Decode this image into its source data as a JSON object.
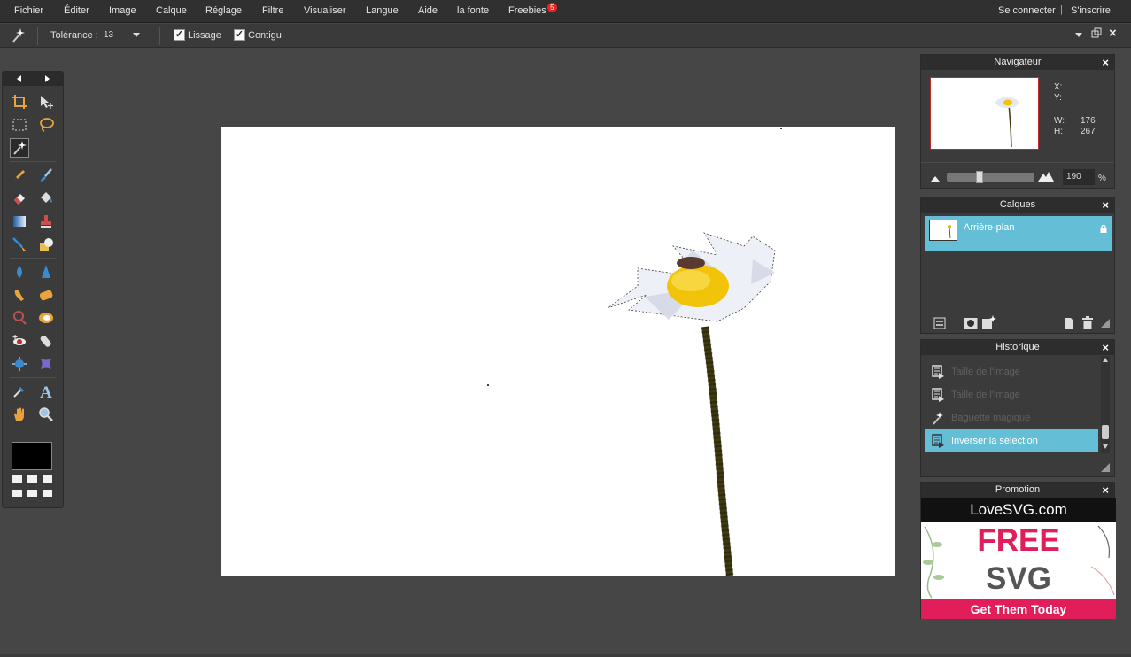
{
  "menu": {
    "items": [
      "Fichier",
      "Éditer",
      "Image",
      "Calque",
      "Réglage",
      "Filtre",
      "Visualiser",
      "Langue",
      "Aide",
      "la fonte",
      "Freebies"
    ],
    "freebies_badge": "5",
    "sign_in": "Se connecter",
    "separator": "|",
    "register": "S'inscrire"
  },
  "options": {
    "tool_icon": "magic-wand-icon",
    "tolerance_label": "Tolérance :",
    "tolerance_value": "13",
    "smoothing_label": "Lissage",
    "smoothing_checked": true,
    "contiguous_label": "Contigu",
    "contiguous_checked": true,
    "check_mark": "✓"
  },
  "navigator": {
    "title": "Navigateur",
    "x_label": "X:",
    "y_label": "Y:",
    "w_label": "W:",
    "w_value": "176",
    "h_label": "H:",
    "h_value": "267",
    "zoom_value": "190",
    "zoom_unit": "%",
    "zoom_level": 0.38
  },
  "layers": {
    "title": "Calques",
    "items": [
      {
        "name": "Arrière-plan",
        "locked": true,
        "selected": true
      }
    ]
  },
  "history": {
    "title": "Historique",
    "items": [
      {
        "label": "Taille de l'image",
        "icon": "document-icon",
        "active": false
      },
      {
        "label": "Taille de l'image",
        "icon": "document-icon",
        "active": false
      },
      {
        "label": "Baguette magique",
        "icon": "magic-wand-icon",
        "active": false
      },
      {
        "label": "Inverser la sélection",
        "icon": "document-icon",
        "active": true
      }
    ]
  },
  "promotion": {
    "title": "Promotion",
    "brand": "LoveSVG.com",
    "line1": "FREE",
    "line2": "SVG",
    "cta": "Get Them Today"
  },
  "close_glyph": "×",
  "colors": {
    "accent": "#64bfd6",
    "promo_pink": "#e11d5a",
    "badge": "#e22222",
    "background": "#464646"
  }
}
